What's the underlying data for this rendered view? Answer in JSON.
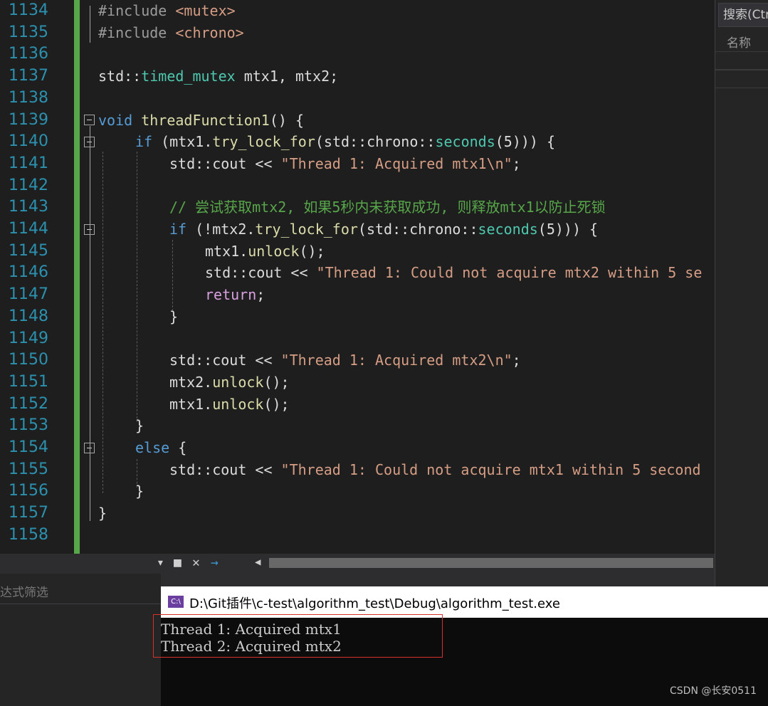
{
  "editor": {
    "line_numbers": [
      "1134",
      "1135",
      "1136",
      "1137",
      "1138",
      "1139",
      "1140",
      "1141",
      "1142",
      "1143",
      "1144",
      "1145",
      "1146",
      "1147",
      "1148",
      "1149",
      "1150",
      "1151",
      "1152",
      "1153",
      "1154",
      "1155",
      "1156",
      "1157",
      "1158"
    ],
    "code": {
      "l1134": {
        "kw": "#include",
        "rest": " <mutex>"
      },
      "l1135": {
        "kw": "#include",
        "rest": " <chrono>"
      },
      "l1137": {
        "ns": "std::",
        "type": "timed_mutex",
        "rest": " mtx1, mtx2;"
      },
      "l1139": {
        "kw": "void",
        "fn": "threadFunction1",
        "rest": "() {"
      },
      "l1140": {
        "kw": "if",
        "a": " (mtx1.",
        "fn": "try_lock_for",
        "b": "(std::chrono::",
        "fn2": "seconds",
        "c": "(5))) {"
      },
      "l1141": {
        "a": "std::cout << ",
        "str": "\"Thread 1: Acquired mtx1\\n\"",
        "b": ";"
      },
      "l1143": {
        "comment": "// 尝试获取mtx2, 如果5秒内未获取成功, 则释放mtx1以防止死锁"
      },
      "l1144": {
        "kw": "if",
        "a": " (!mtx2.",
        "fn": "try_lock_for",
        "b": "(std::chrono::",
        "fn2": "seconds",
        "c": "(5))) {"
      },
      "l1145": {
        "a": "mtx1.",
        "fn": "unlock",
        "b": "();"
      },
      "l1146": {
        "a": "std::cout << ",
        "str": "\"Thread 1: Could not acquire mtx2 within 5 se"
      },
      "l1147": {
        "kw": "return",
        "b": ";"
      },
      "l1148": {
        "a": "}"
      },
      "l1150": {
        "a": "std::cout << ",
        "str": "\"Thread 1: Acquired mtx2\\n\"",
        "b": ";"
      },
      "l1151": {
        "a": "mtx2.",
        "fn": "unlock",
        "b": "();"
      },
      "l1152": {
        "a": "mtx1.",
        "fn": "unlock",
        "b": "();"
      },
      "l1153": {
        "a": "}"
      },
      "l1154": {
        "kw": "else",
        "a": " {"
      },
      "l1155": {
        "a": "std::cout << ",
        "str": "\"Thread 1: Could not acquire mtx1 within 5 second"
      },
      "l1156": {
        "a": "}"
      },
      "l1157": {
        "a": "}"
      }
    },
    "colors": {
      "keyword": "#569cd6",
      "function": "#dcdcaa",
      "type": "#4ec9b0",
      "string": "#d69d85",
      "comment": "#57a64a",
      "control": "#d8a0df",
      "line_number": "#2b91af"
    }
  },
  "solution_explorer": {
    "search_label": "搜索(Ctr",
    "column_name": "名称"
  },
  "left_panel": {
    "filter_label": "达式筛选"
  },
  "console": {
    "icon_text": "C:\\",
    "title": "D:\\Git插件\\c-test\\algorithm_test\\Debug\\algorithm_test.exe",
    "output": [
      "Thread 1: Acquired mtx1",
      "Thread 2: Acquired mtx2"
    ]
  },
  "watermark": "CSDN @长安0511"
}
